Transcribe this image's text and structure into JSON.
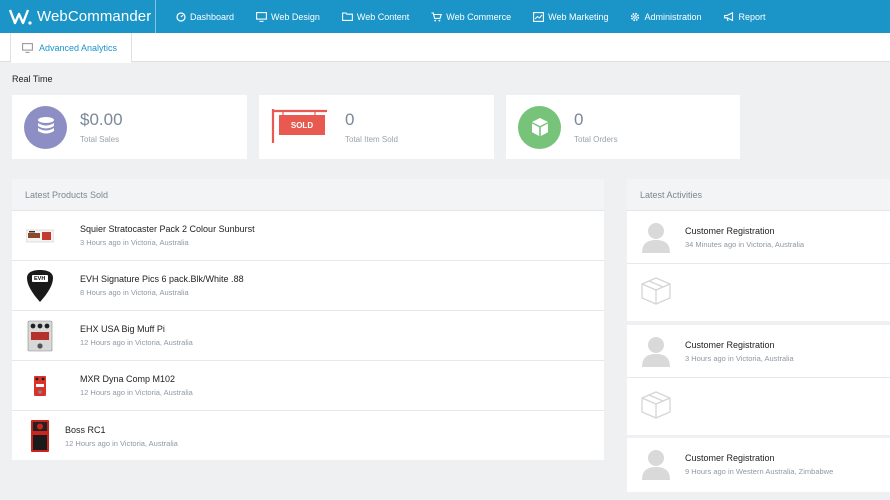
{
  "app": {
    "name": "WebCommander"
  },
  "nav": [
    {
      "label": "Dashboard",
      "icon": "dashboard-icon"
    },
    {
      "label": "Web Design",
      "icon": "monitor-icon"
    },
    {
      "label": "Web Content",
      "icon": "folder-icon"
    },
    {
      "label": "Web Commerce",
      "icon": "cart-icon"
    },
    {
      "label": "Web Marketing",
      "icon": "chart-icon"
    },
    {
      "label": "Administration",
      "icon": "gear-icon"
    },
    {
      "label": "Report",
      "icon": "megaphone-icon"
    }
  ],
  "tab": {
    "label": "Advanced Analytics"
  },
  "realtime": {
    "title": "Real Time",
    "sales": {
      "value": "$0.00",
      "label": "Total Sales",
      "color": "#8d8fc4"
    },
    "items": {
      "value": "0",
      "label": "Total Item Sold",
      "badge": "SOLD",
      "color": "#e85a4f"
    },
    "orders": {
      "value": "0",
      "label": "Total Orders",
      "color": "#77c37a"
    }
  },
  "products": {
    "title": "Latest Products Sold",
    "items": [
      {
        "name": "Squier Stratocaster Pack 2 Colour Sunburst",
        "meta": "3 Hours ago in Victoria, Australia"
      },
      {
        "name": "EVH Signature Pics 6 pack.Blk/White .88",
        "meta": "8 Hours ago in Victoria, Australia",
        "badge": "EVH"
      },
      {
        "name": "EHX USA Big Muff Pi",
        "meta": "12 Hours ago in Victoria, Australia"
      },
      {
        "name": "MXR Dyna Comp M102",
        "meta": "12 Hours ago in Victoria, Australia"
      },
      {
        "name": "Boss RC1",
        "meta": "12 Hours ago in Victoria, Australia"
      }
    ]
  },
  "activities": {
    "title": "Latest Activities",
    "items": [
      {
        "name": "Customer Registration",
        "meta": "34 Minutes ago in Victoria, Australia"
      },
      {
        "name": "Customer Registration",
        "meta": "3 Hours ago in Victoria, Australia"
      },
      {
        "name": "Customer Registration",
        "meta": "9 Hours ago in Western Australia, Zimbabwe"
      }
    ]
  }
}
